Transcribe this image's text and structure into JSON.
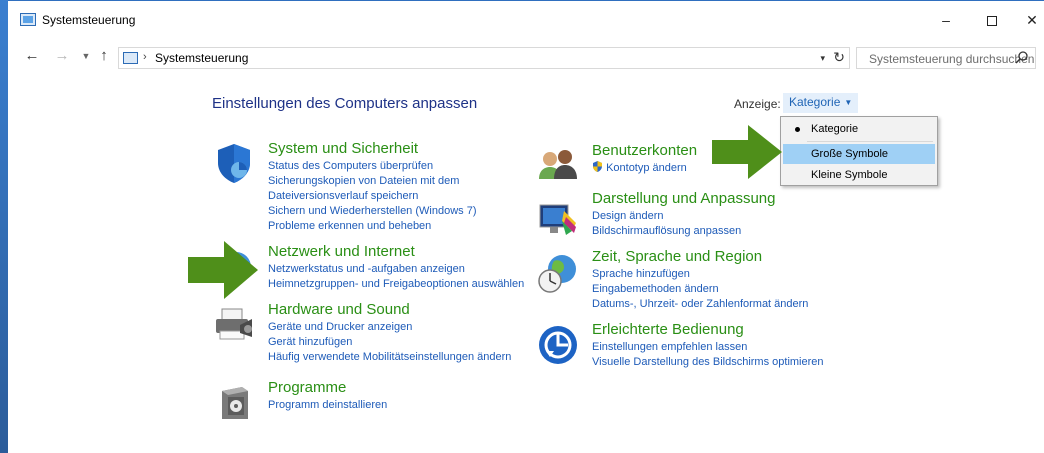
{
  "window": {
    "title": "Systemsteuerung",
    "minimize": "–",
    "close": "✕"
  },
  "nav": {
    "back_icon": "←",
    "forward_icon": "→",
    "recent_icon": "▼",
    "up_icon": "↑",
    "breadcrumb_separator": "›",
    "breadcrumb": "Systemsteuerung",
    "address_dropdown": "▾",
    "refresh": "↻",
    "search_placeholder": "Systemsteuerung durchsuchen"
  },
  "main": {
    "title": "Einstellungen des Computers anpassen",
    "view_label": "Anzeige:",
    "view_value": "Kategorie",
    "view_caret": "▼"
  },
  "view_menu": {
    "items": [
      "Kategorie",
      "Große Symbole",
      "Kleine Symbole"
    ],
    "selected": "Kategorie",
    "highlighted": "Große Symbole"
  },
  "categories_left": [
    {
      "icon": "shield-icon",
      "title": "System und Sicherheit",
      "links": [
        "Status des Computers überprüfen",
        "Sicherungskopien von Dateien mit dem",
        "Dateiversionsverlauf speichern",
        "Sichern und Wiederherstellen (Windows 7)",
        "Probleme erkennen und beheben"
      ]
    },
    {
      "icon": "globe-network-icon",
      "title": "Netzwerk und Internet",
      "links": [
        "Netzwerkstatus und -aufgaben anzeigen",
        "Heimnetzgruppen- und Freigabeoptionen auswählen"
      ]
    },
    {
      "icon": "printer-icon",
      "title": "Hardware und Sound",
      "links": [
        "Geräte und Drucker anzeigen",
        "Gerät hinzufügen",
        "Häufig verwendete Mobilitätseinstellungen ändern"
      ]
    },
    {
      "icon": "programs-box-icon",
      "title": "Programme",
      "links": [
        "Programm deinstallieren"
      ]
    }
  ],
  "categories_right": [
    {
      "icon": "users-icon",
      "title": "Benutzerkonten",
      "links": [
        "Kontotyp ändern"
      ]
    },
    {
      "icon": "monitor-paint-icon",
      "title": "Darstellung und Anpassung",
      "links": [
        "Design ändern",
        "Bildschirmauflösung anpassen"
      ]
    },
    {
      "icon": "globe-clock-icon",
      "title": "Zeit, Sprache und Region",
      "links": [
        "Sprache hinzufügen",
        "Eingabemethoden ändern",
        "Datums-, Uhrzeit- oder Zahlenformat ändern"
      ]
    },
    {
      "icon": "ease-of-access-icon",
      "title": "Erleichterte Bedienung",
      "links": [
        "Einstellungen empfehlen lassen",
        "Visuelle Darstellung des Bildschirms optimieren"
      ]
    }
  ],
  "colors": {
    "category_title": "#2a8f15",
    "link": "#1e5bb8",
    "heading": "#1e3287",
    "annotation_arrow": "#4f8f1a",
    "menu_highlight": "#9fd0f5"
  }
}
